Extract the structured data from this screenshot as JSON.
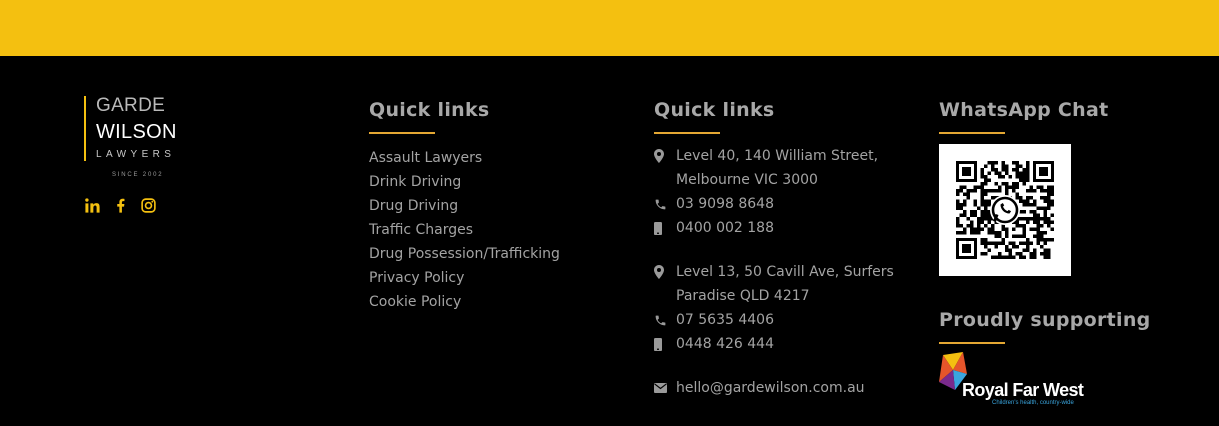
{
  "colors": {
    "accent_band": "#f4c010",
    "underline": "#e4a733",
    "background": "#000000",
    "rfw_blue": "#3aa5de"
  },
  "logo": {
    "line1": "GARDE",
    "line2": "WILSON",
    "line3": "LAWYERS",
    "line4": "SINCE 2002"
  },
  "social": {
    "icons": [
      "linkedin-icon",
      "facebook-icon",
      "instagram-icon"
    ]
  },
  "quick_links": {
    "heading": "Quick links",
    "items": [
      "Assault Lawyers",
      "Drink Driving",
      "Drug Driving",
      "Traffic Charges",
      "Drug Possession/Trafficking",
      "Privacy Policy",
      "Cookie Policy"
    ]
  },
  "contact": {
    "heading": "Quick links",
    "melbourne": {
      "address_line1": "Level 40, 140 William Street,",
      "address_line2": "Melbourne VIC 3000",
      "phone": "03 9098 8648",
      "mobile": "0400 002 188"
    },
    "surfers": {
      "address_line1": "Level 13, 50 Cavill Ave, Surfers",
      "address_line2": "Paradise QLD 4217",
      "phone": "07 5635 4406",
      "mobile": "0448 426 444"
    },
    "email": "hello@gardewilson.com.au",
    "icons": [
      "location-pin-icon",
      "phone-icon",
      "mobile-icon",
      "email-icon"
    ]
  },
  "whatsapp": {
    "heading": "WhatsApp Chat",
    "qr_icon": "whatsapp-icon"
  },
  "supporting": {
    "heading": "Proudly supporting",
    "org_name": "Royal Far West",
    "org_tagline": "Children's health, country-wide"
  }
}
